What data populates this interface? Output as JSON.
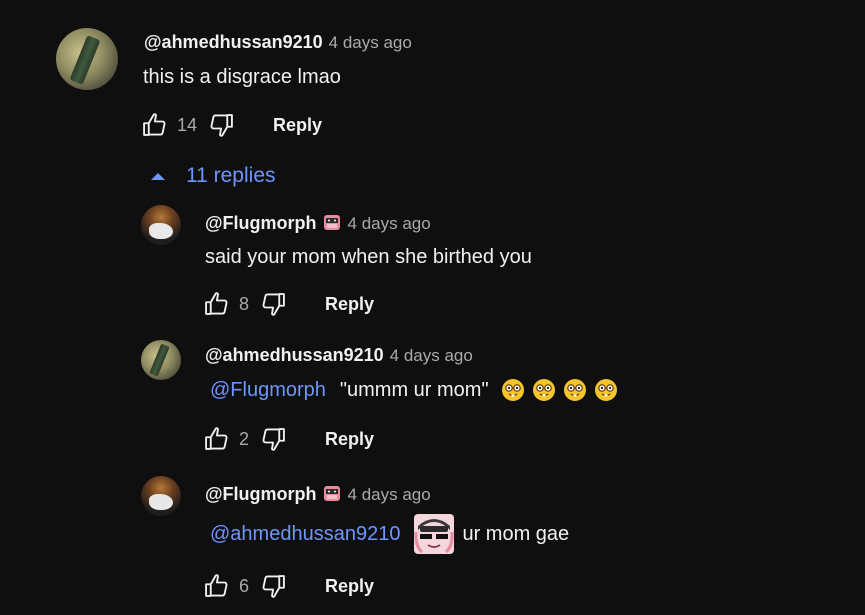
{
  "top_comment": {
    "author": "@ahmedhussan9210",
    "time": "4 days ago",
    "text": "this is a disgrace lmao",
    "likes": "14",
    "reply_label": "Reply",
    "avatar_icon": "user-avatar-icon"
  },
  "replies_toggle": {
    "label": "11 replies",
    "icon": "caret-up-icon",
    "color": "#6e96ff"
  },
  "replies": [
    {
      "author": "@Flugmorph",
      "time": "4 days ago",
      "text": "said your mom when she birthed you",
      "likes": "8",
      "reply_label": "Reply"
    },
    {
      "author": "@ahmedhussan9210",
      "time": "4 days ago",
      "mention": "@Flugmorph",
      "text": "\"ummm ur mom\"",
      "likes": "2",
      "reply_label": "Reply"
    },
    {
      "author": "@Flugmorph",
      "time": "4 days ago",
      "mention": "@ahmedhussan9210",
      "text": "ur mom gae",
      "likes": "6",
      "reply_label": "Reply"
    }
  ],
  "colors": {
    "background": "#0f0f0f",
    "text": "#f1f1f1",
    "secondary": "#aaaaaa",
    "link": "#6e96ff"
  }
}
